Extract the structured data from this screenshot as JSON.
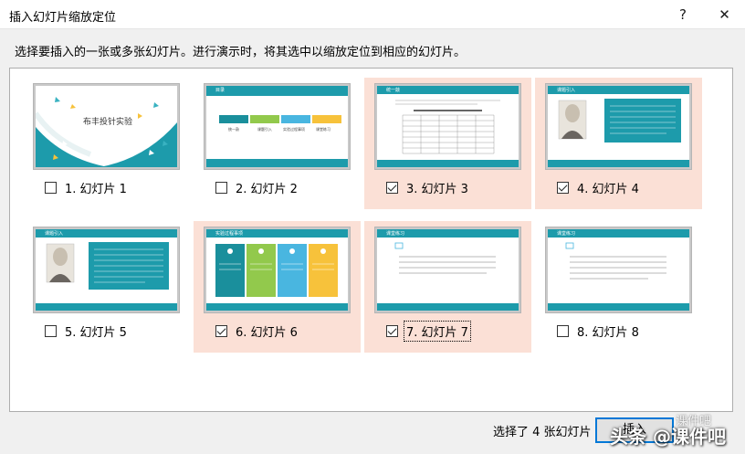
{
  "dialog": {
    "title": "插入幻灯片缩放定位",
    "help_label": "?",
    "close_label": "✕"
  },
  "instruction": "选择要插入的一张或多张幻灯片。进行演示时，将其选中以缩放定位到相应的幻灯片。",
  "slides": [
    {
      "label": "1. 幻灯片 1",
      "checked": false,
      "title": "布丰投针实验",
      "heading": ""
    },
    {
      "label": "2. 幻灯片 2",
      "checked": false,
      "title": "",
      "heading": "目录"
    },
    {
      "label": "3. 幻灯片 3",
      "checked": true,
      "title": "",
      "heading": "统一敲"
    },
    {
      "label": "4. 幻灯片 4",
      "checked": true,
      "title": "",
      "heading": "课题引入"
    },
    {
      "label": "5. 幻灯片 5",
      "checked": false,
      "title": "",
      "heading": "课题引入"
    },
    {
      "label": "6. 幻灯片 6",
      "checked": true,
      "title": "",
      "heading": "实验过程事项"
    },
    {
      "label": "7. 幻灯片 7",
      "checked": true,
      "title": "",
      "heading": "课堂练习"
    },
    {
      "label": "8. 幻灯片 8",
      "checked": false,
      "title": "",
      "heading": "课堂练习"
    }
  ],
  "toc_items": [
    "统一敲",
    "课题引入",
    "实验过程事项",
    "课堂练习"
  ],
  "footer": {
    "status": "选择了 4 张幻灯片",
    "confirm_label": "插入"
  },
  "watermark": {
    "top": "课件吧",
    "main": "头条 @课件吧"
  },
  "colors": {
    "teal": "#1d9bab",
    "selected_bg": "#fbe0d6",
    "toc_teal": "#1a8f9c",
    "toc_green": "#92c94c",
    "toc_blue": "#49b6e0",
    "toc_yellow": "#f7c23b"
  }
}
